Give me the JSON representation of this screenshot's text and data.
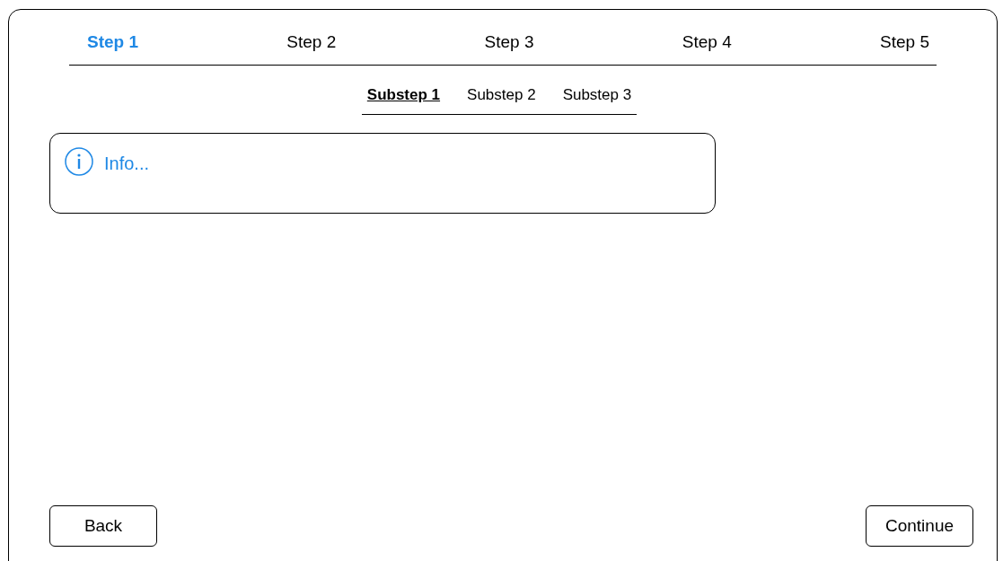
{
  "steps": [
    {
      "label": "Step 1",
      "selected": true
    },
    {
      "label": "Step 2",
      "selected": false
    },
    {
      "label": "Step 3",
      "selected": false
    },
    {
      "label": "Step 4",
      "selected": false
    },
    {
      "label": "Step 5",
      "selected": false
    }
  ],
  "substeps": [
    {
      "label": "Substep 1",
      "selected": true
    },
    {
      "label": "Substep 2",
      "selected": false
    },
    {
      "label": "Substep 3",
      "selected": false
    }
  ],
  "info": {
    "text": "Info..."
  },
  "buttons": {
    "back": "Back",
    "continue": "Continue"
  }
}
